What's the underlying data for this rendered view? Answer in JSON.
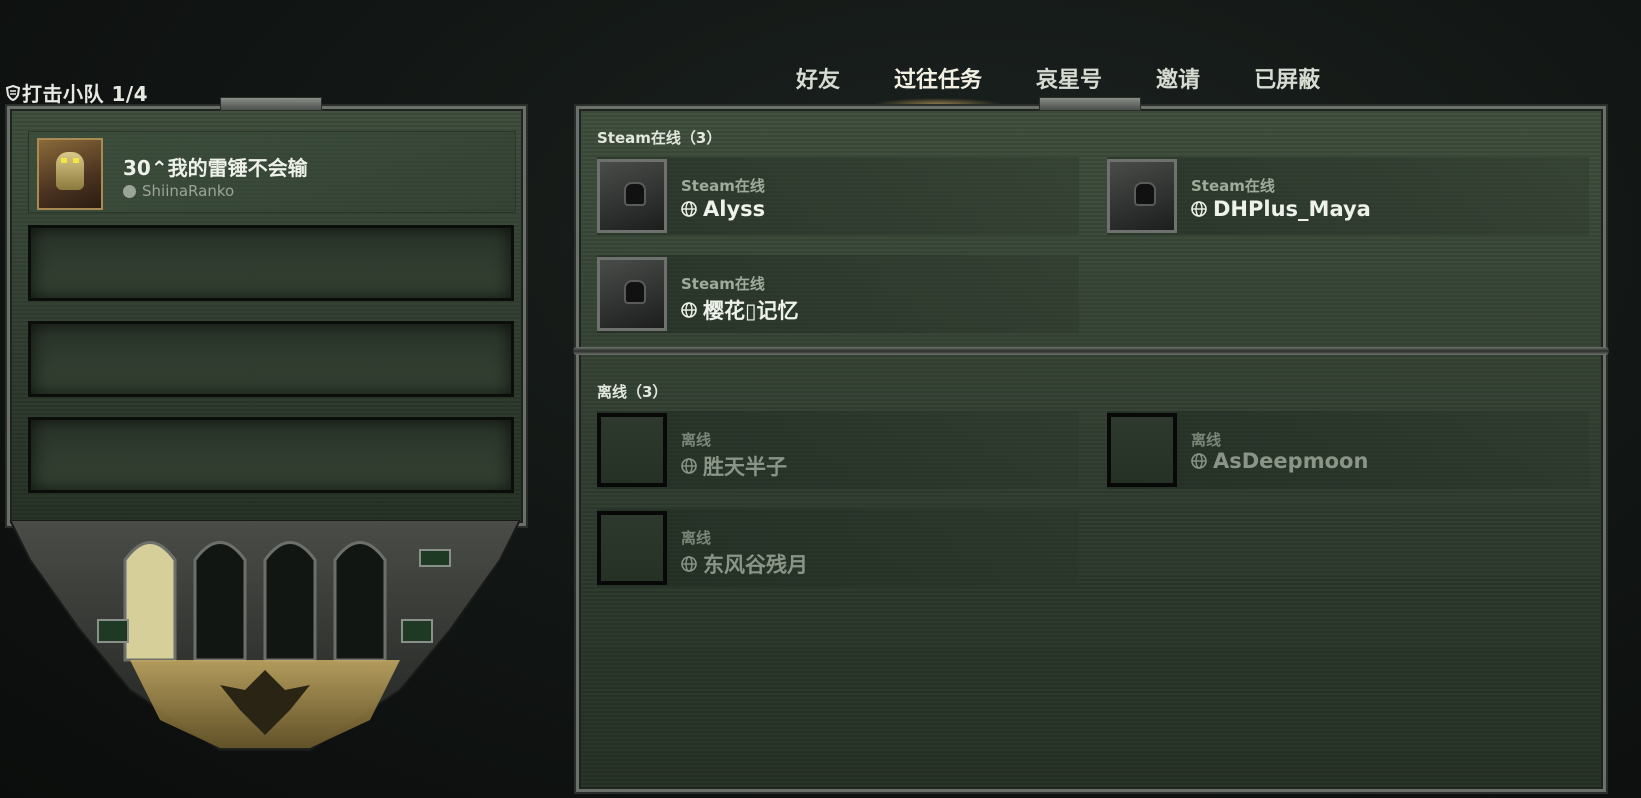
{
  "squad": {
    "title": "打击小队 1/4"
  },
  "tabs": [
    {
      "label": "好友"
    },
    {
      "label": "过往任务"
    },
    {
      "label": "哀星号"
    },
    {
      "label": "邀请"
    },
    {
      "label": "已屏蔽"
    }
  ],
  "member": {
    "name": "30⌃我的雷锤不会输",
    "account": "ShiinaRanko"
  },
  "online_section": {
    "label": "Steam在线（3）"
  },
  "offline_section": {
    "label": "离线（3）"
  },
  "online_friends": [
    {
      "status": "Steam在线",
      "name": "Alyss"
    },
    {
      "status": "Steam在线",
      "name": "DHPlus_Maya"
    },
    {
      "status": "Steam在线",
      "name": "樱花▯记忆"
    }
  ],
  "offline_friends": [
    {
      "status": "离线",
      "name": "胜天半子"
    },
    {
      "status": "离线",
      "name": "AsDeepmoon"
    },
    {
      "status": "离线",
      "name": "东风谷残月"
    }
  ],
  "colors": {
    "panel": "#2d3a2d",
    "active_tab_glow": "#e6be6e",
    "frame": "#6b706b"
  },
  "icons": {
    "squad": "shield-icon",
    "platform": "steam-icon",
    "region": "globe-icon"
  }
}
